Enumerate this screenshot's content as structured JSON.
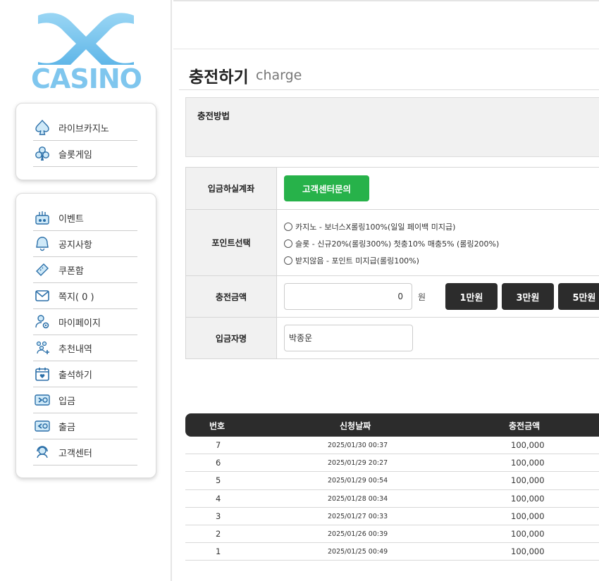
{
  "brand": {
    "logo_text": "CASINO",
    "primary_color": "#7fc6ee"
  },
  "sidebar": {
    "games": [
      {
        "label": "라이브카지노",
        "icon": "spade-icon"
      },
      {
        "label": "슬롯게임",
        "icon": "club-icon"
      }
    ],
    "items": [
      {
        "label": "이벤트",
        "icon": "event-icon"
      },
      {
        "label": "공지사항",
        "icon": "bell-icon"
      },
      {
        "label": "쿠폰함",
        "icon": "coupon-icon"
      },
      {
        "label": "쪽지( 0 )",
        "icon": "mail-icon"
      },
      {
        "label": "마이페이지",
        "icon": "user-gear-icon"
      },
      {
        "label": "추천내역",
        "icon": "users-add-icon"
      },
      {
        "label": "출석하기",
        "icon": "calendar-heart-icon"
      },
      {
        "label": "입금",
        "icon": "deposit-icon"
      },
      {
        "label": "출금",
        "icon": "withdraw-icon"
      },
      {
        "label": "고객센터",
        "icon": "headset-icon"
      }
    ]
  },
  "page": {
    "title": "충전하기",
    "subtitle": "charge"
  },
  "method": {
    "label": "충전방법"
  },
  "form": {
    "account_label": "입금하실계좌",
    "account_button": "고객센터문의",
    "point_label": "포인트선택",
    "point_options": [
      "카지노 - 보너스X롤링100%(일일 페이백 미지급)",
      "슬롯 - 신규20%(롤링300%) 첫충10% 매충5% (롤링200%)",
      "받지않음 - 포인트 미지급(롤링100%)"
    ],
    "amount_label": "충전금액",
    "amount_value": "0",
    "amount_unit": "원",
    "quick_amounts": [
      "1만원",
      "3만원",
      "5만원"
    ],
    "depositor_label": "입금자명",
    "depositor_value": "박종운"
  },
  "history": {
    "headers": {
      "no": "번호",
      "date": "신청날짜",
      "amount": "충전금액"
    },
    "rows": [
      {
        "no": "7",
        "date": "2025/01/30 00:37",
        "amount": "100,000"
      },
      {
        "no": "6",
        "date": "2025/01/29 20:27",
        "amount": "100,000"
      },
      {
        "no": "5",
        "date": "2025/01/29 00:54",
        "amount": "100,000"
      },
      {
        "no": "4",
        "date": "2025/01/28 00:34",
        "amount": "100,000"
      },
      {
        "no": "3",
        "date": "2025/01/27 00:33",
        "amount": "100,000"
      },
      {
        "no": "2",
        "date": "2025/01/26 00:39",
        "amount": "100,000"
      },
      {
        "no": "1",
        "date": "2025/01/25 00:49",
        "amount": "100,000"
      }
    ]
  }
}
